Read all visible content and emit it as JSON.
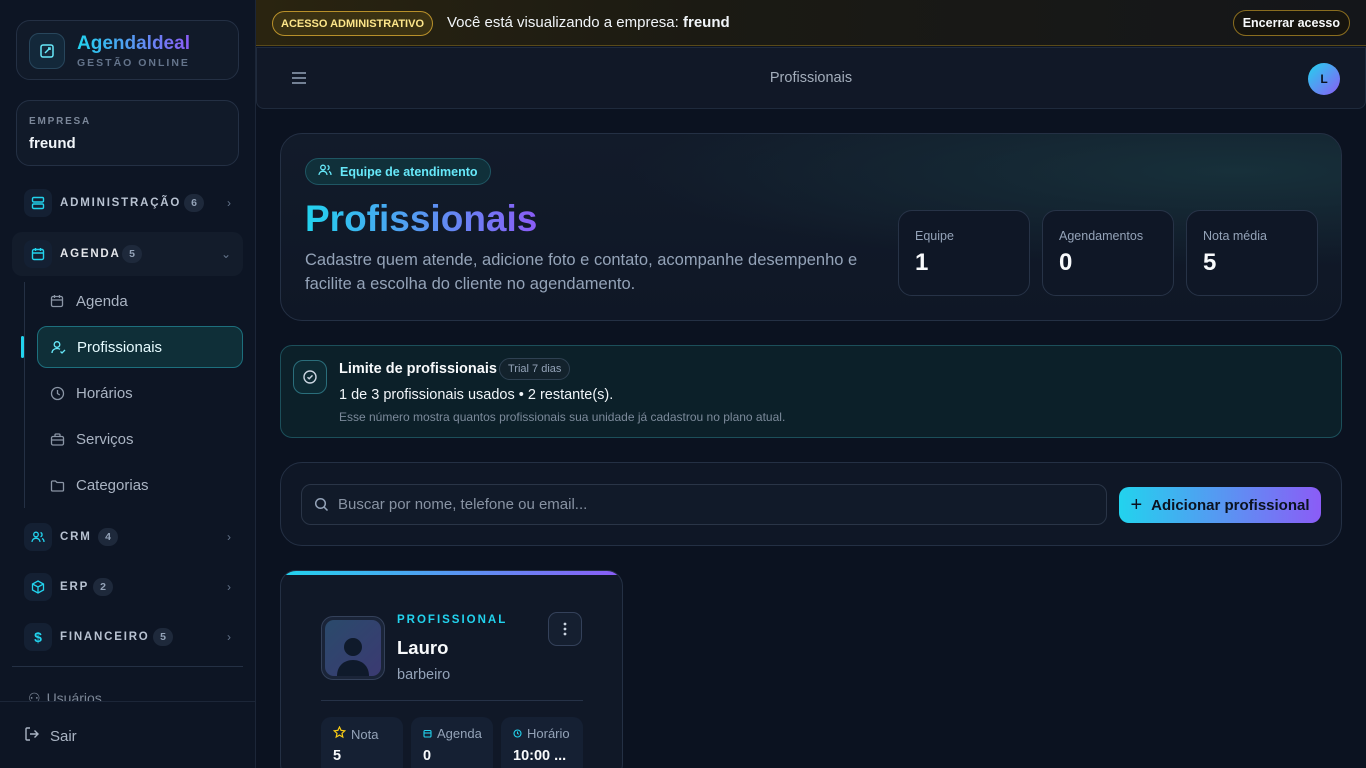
{
  "sidebar": {
    "brand": {
      "name": "Agendaldeal",
      "subtitle": "GESTÃO ONLINE"
    },
    "company": {
      "label": "EMPRESA",
      "name": "freund"
    },
    "groups": [
      {
        "label": "ADMINISTRAÇÃO",
        "count": "6"
      },
      {
        "label": "AGENDA",
        "count": "5"
      },
      {
        "label": "CRM",
        "count": "4"
      },
      {
        "label": "ERP",
        "count": "2"
      },
      {
        "label": "FINANCEIRO",
        "count": "5"
      }
    ],
    "agenda_items": [
      {
        "label": "Agenda"
      },
      {
        "label": "Profissionais"
      },
      {
        "label": "Horários"
      },
      {
        "label": "Serviços"
      },
      {
        "label": "Categorias"
      }
    ],
    "usuarios_label": "Usuários",
    "logout_label": "Sair"
  },
  "admin_banner": {
    "pill": "ACESSO ADMINISTRATIVO",
    "text": "Você está visualizando a empresa:",
    "company": "freund",
    "end_button": "Encerrar acesso"
  },
  "topbar": {
    "title": "Profissionais",
    "avatar_initial": "L"
  },
  "hero": {
    "pill": "Equipe de atendimento",
    "title": "Profissionais",
    "description": "Cadastre quem atende, adicione foto e contato, acompanhe desempenho e facilite a escolha do cliente no agendamento.",
    "stats": [
      {
        "label": "Equipe",
        "value": "1"
      },
      {
        "label": "Agendamentos",
        "value": "0"
      },
      {
        "label": "Nota média",
        "value": "5"
      }
    ]
  },
  "limit": {
    "title": "Limite de profissionais",
    "plan": "Trial 7 dias",
    "usage": "1 de 3 profissionais usados • 2 restante(s).",
    "note": "Esse número mostra quantos profissionais sua unidade já cadastrou no plano atual."
  },
  "search": {
    "placeholder": "Buscar por nome, telefone ou email...",
    "add_button": "Adicionar profissional"
  },
  "professionals": [
    {
      "kicker": "PROFISSIONAL",
      "name": "Lauro",
      "role": "barbeiro",
      "stats": [
        {
          "label": "Nota",
          "value": "5"
        },
        {
          "label": "Agenda",
          "value": "0"
        },
        {
          "label": "Horário",
          "value": "10:00 ..."
        }
      ]
    }
  ],
  "colors": {
    "accent_cyan": "#22d3ee",
    "accent_violet": "#8b5cf6",
    "admin_gold": "#fde68a"
  }
}
